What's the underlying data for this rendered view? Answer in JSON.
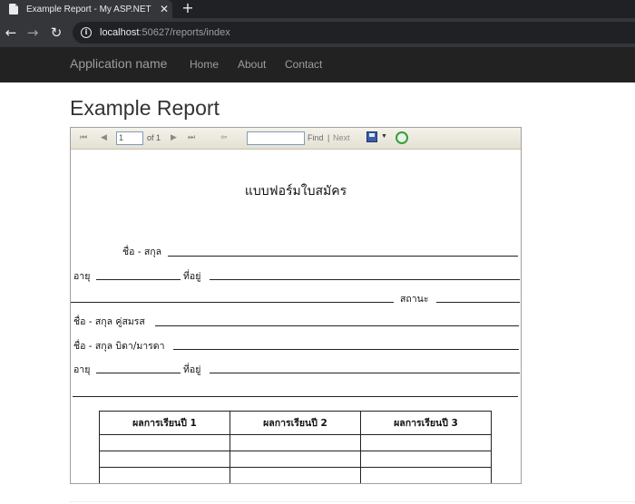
{
  "browser": {
    "tab_title": "Example Report - My ASP.NET Ap",
    "tab_close": "✕",
    "new_tab": "+",
    "back": "←",
    "forward": "→",
    "reload": "↻",
    "url_host": "localhost",
    "url_rest": ":50627/reports/index"
  },
  "navbar": {
    "brand": "Application name",
    "links": [
      "Home",
      "About",
      "Contact"
    ]
  },
  "page": {
    "title": "Example Report"
  },
  "report_toolbar": {
    "first": "⏮",
    "prev": "◀",
    "page_value": "1",
    "of_label": "of 1",
    "next_page": "▶",
    "last": "⏭",
    "back_parent": "⇦",
    "find_value": "",
    "find": "Find",
    "separator": "|",
    "next": "Next",
    "export_caret": "▼"
  },
  "report": {
    "form_title": "แบบฟอร์มใบสมัคร",
    "name_label": "ชื่อ - สกุล",
    "age_label": "อายุ",
    "address_label": "ที่อยู่",
    "status_label": "สถานะ",
    "spouse_label": "ชื่อ - สกุล คู่สมรส",
    "parent_label": "ชื่อ - สกุล บิดา/มารดา",
    "age_label_2": "อายุ",
    "address_label_2": "ที่อยู่",
    "table_headers": [
      "ผลการเรียนปี 1",
      "ผลการเรียนปี 2",
      "ผลการเรียนปี 3"
    ],
    "table_rows": [
      [
        "",
        "",
        ""
      ],
      [
        "",
        "",
        ""
      ],
      [
        "",
        "",
        ""
      ]
    ]
  },
  "colors": {
    "browser_dark": "#202124",
    "browser_toolbar": "#35363a",
    "navbar": "#222222",
    "navbar_text": "#9d9d9d"
  }
}
